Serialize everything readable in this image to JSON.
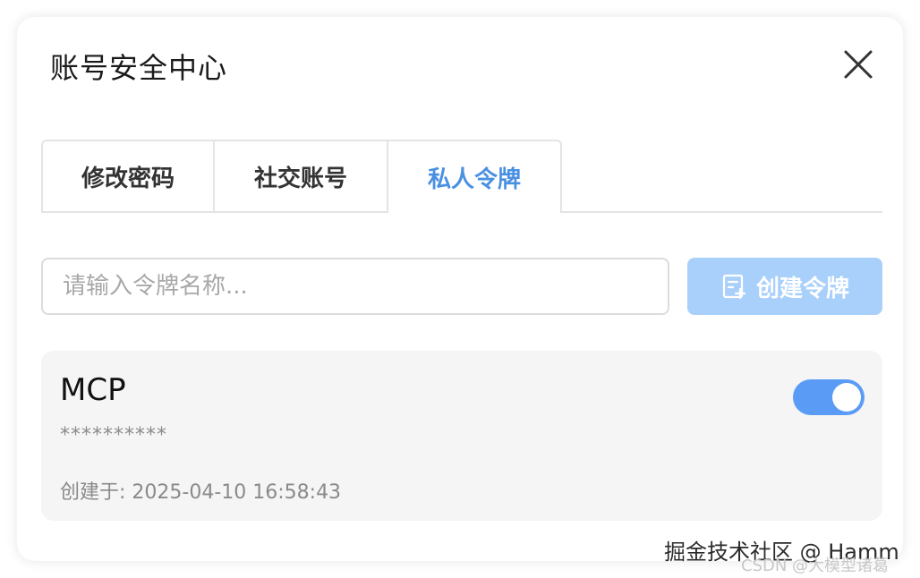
{
  "dialog": {
    "title": "账号安全中心",
    "close_icon": "close-icon"
  },
  "tabs": [
    {
      "label": "修改密码",
      "active": false
    },
    {
      "label": "社交账号",
      "active": false
    },
    {
      "label": "私人令牌",
      "active": true
    }
  ],
  "token_form": {
    "name_placeholder": "请输入令牌名称...",
    "name_value": "",
    "create_button_label": "创建令牌",
    "create_button_icon": "add-document-icon"
  },
  "tokens": [
    {
      "name": "MCP",
      "masked_value": "**********",
      "created_label": "创建于: 2025-04-10 16:58:43",
      "enabled": true
    }
  ],
  "watermark": {
    "primary": "掘金技术社区 @ Hamm",
    "secondary": "CSDN @大模型诸葛"
  },
  "colors": {
    "accent": "#4a90e2",
    "button_disabled_bg": "#a9d0fb",
    "toggle_on": "#5a9cf5",
    "card_bg": "#f5f5f5"
  }
}
